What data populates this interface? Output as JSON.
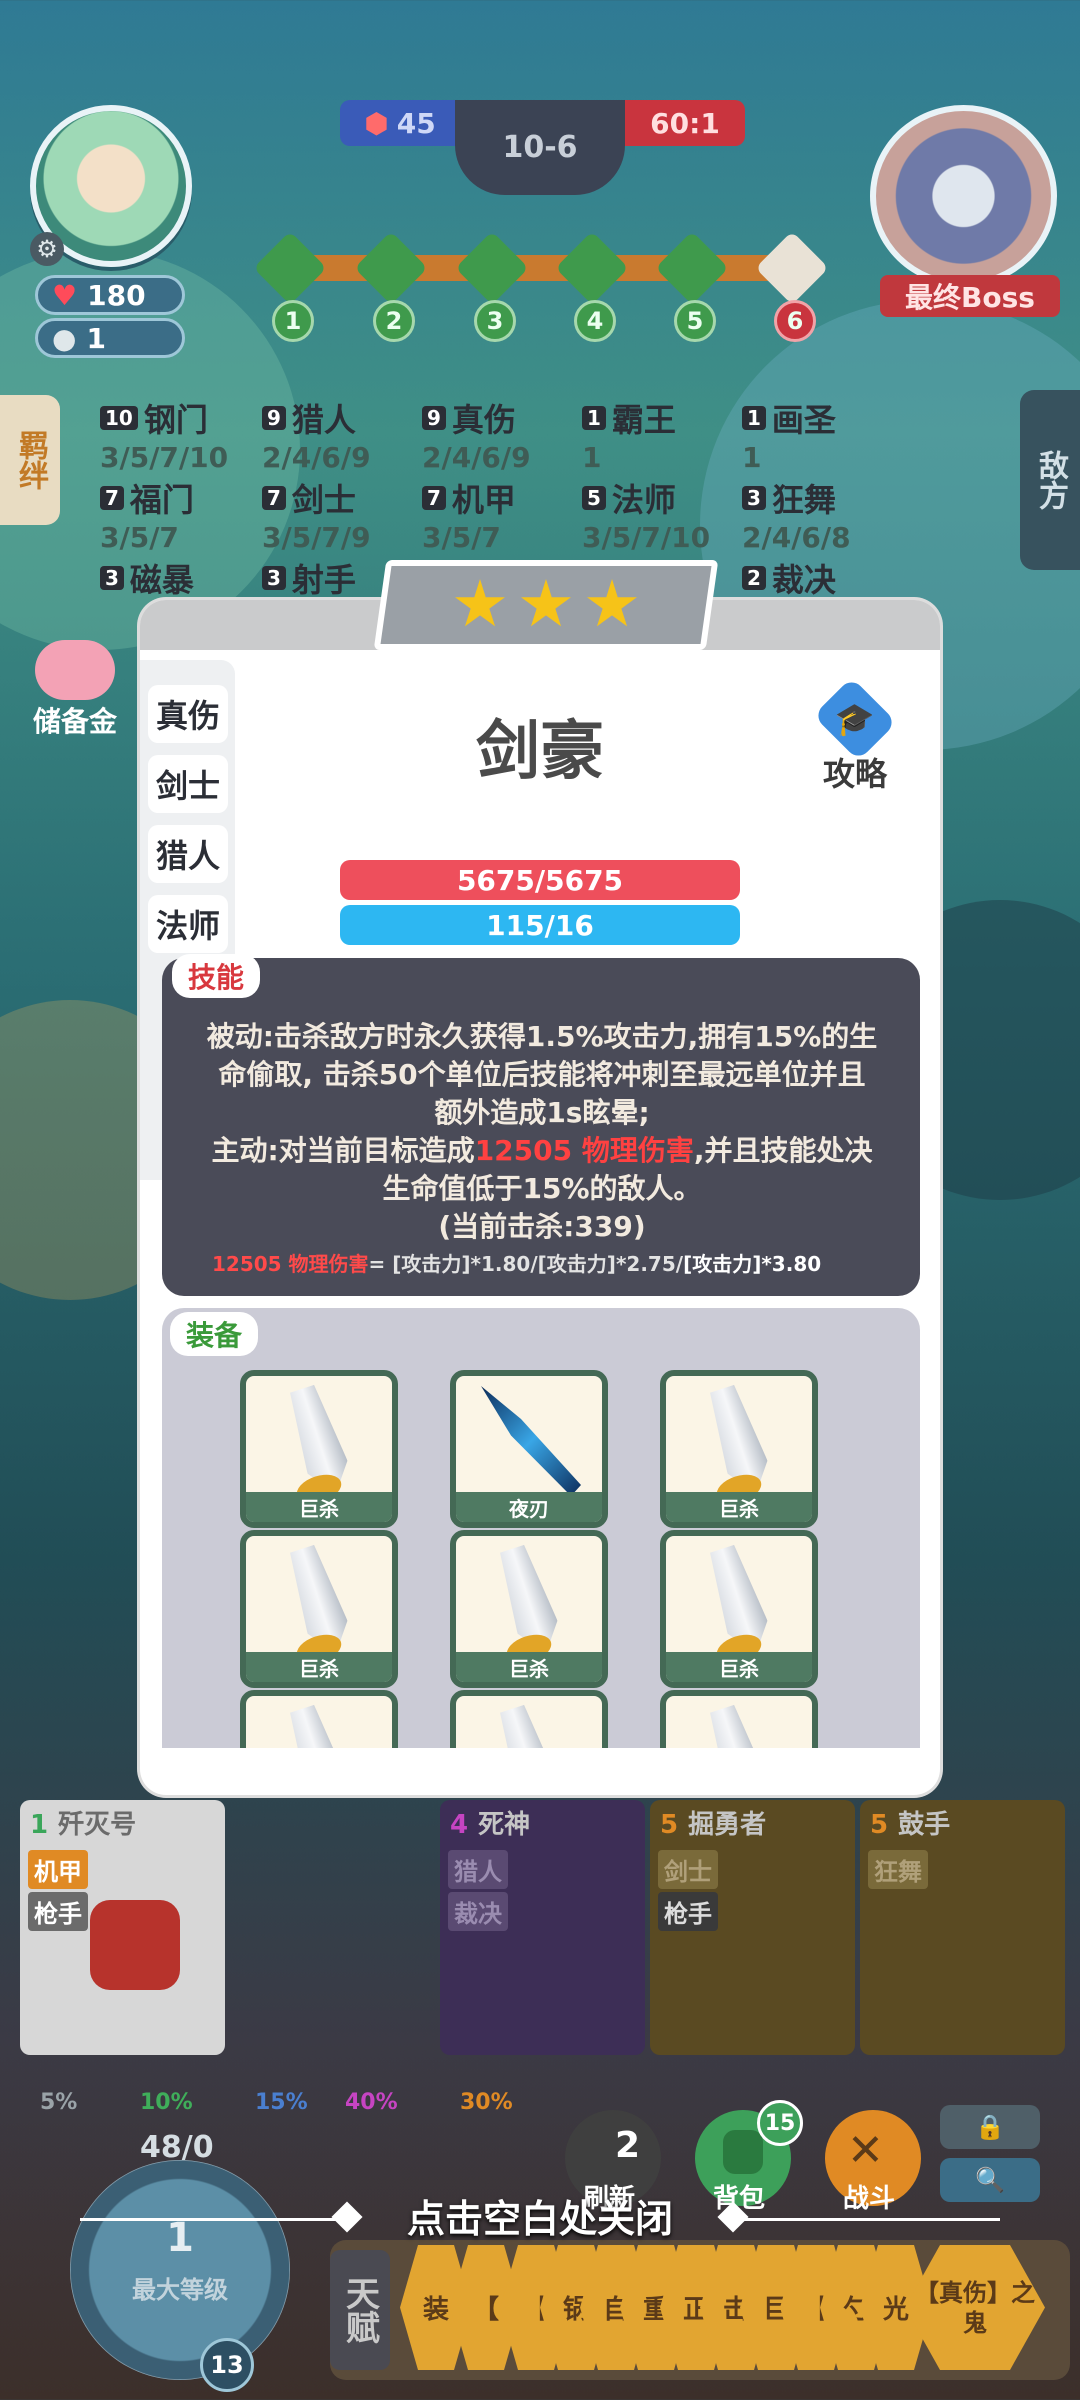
{
  "hud": {
    "hp": "180",
    "coins": "1",
    "left_score": "45",
    "stage": "10-6",
    "right_score": "60:1",
    "boss_label": "最终Boss",
    "nodes": [
      "1",
      "2",
      "3",
      "4",
      "5",
      "6"
    ]
  },
  "side_tabs": {
    "left": "羁绊",
    "right": "敌方",
    "piggy": "储备金"
  },
  "synergies": [
    {
      "count": "10",
      "name": "钢门",
      "tiers": "3/5/7/10"
    },
    {
      "count": "9",
      "name": "猎人",
      "tiers": "2/4/6/9"
    },
    {
      "count": "9",
      "name": "真伤",
      "tiers": "2/4/6/9"
    },
    {
      "count": "1",
      "name": "霸王",
      "tiers": "1"
    },
    {
      "count": "1",
      "name": "画圣",
      "tiers": "1"
    },
    {
      "count": "7",
      "name": "福门",
      "tiers": "3/5/7"
    },
    {
      "count": "7",
      "name": "剑士",
      "tiers": "3/5/7/9"
    },
    {
      "count": "7",
      "name": "机甲",
      "tiers": "3/5/7"
    },
    {
      "count": "5",
      "name": "法师",
      "tiers": "3/5/7/10"
    },
    {
      "count": "3",
      "name": "狂舞",
      "tiers": "2/4/6/8"
    },
    {
      "count": "3",
      "name": "磁暴",
      "tiers": ""
    },
    {
      "count": "3",
      "name": "射手",
      "tiers": ""
    },
    {
      "count": "2",
      "name": "裁决",
      "tiers": ""
    }
  ],
  "modal": {
    "hero_name": "剑豪",
    "guide_label": "攻略",
    "traits": [
      "真伤",
      "剑士",
      "猎人",
      "法师"
    ],
    "hp_bar": "5675/5675",
    "mana_bar": "115/16",
    "skill_tag": "技能",
    "skill_line1": "被动:击杀敌方时永久获得1.5%攻击力,拥有15%的生",
    "skill_line2": "命偷取, 击杀50个单位后技能将冲刺至最远单位并且",
    "skill_line3": "额外造成1s眩晕;",
    "skill_line4a": "主动:对当前目标造成",
    "skill_line4b": "12505 物理伤害",
    "skill_line4c": ",并且技能处决",
    "skill_line5": "生命值低于15%的敌人。",
    "skill_line6": "(当前击杀:339)",
    "formula_red": "12505 物理伤害",
    "formula_rest": "= [攻击力]*1.80/[攻击力]*2.75/",
    "formula_end": "[攻击力]*3.80",
    "equip_tag": "装备",
    "equipment": [
      "巨杀",
      "夜刃",
      "巨杀",
      "巨杀",
      "巨杀",
      "巨杀",
      "",
      "",
      ""
    ]
  },
  "cards": [
    {
      "cost": "1",
      "name": "歼灭号",
      "traits": [
        "机甲",
        "枪手"
      ]
    },
    {
      "cost": "4",
      "name": "死神",
      "traits": [
        "猎人",
        "裁决"
      ]
    },
    {
      "cost": "5",
      "name": "掘勇者",
      "traits": [
        "剑士",
        "枪手"
      ]
    },
    {
      "cost": "5",
      "name": "鼓手",
      "traits": [
        "狂舞"
      ]
    }
  ],
  "odds": [
    "5%",
    "10%",
    "15%",
    "40%",
    "30%"
  ],
  "odds_colors": [
    "#9aa3a8",
    "#3fae5a",
    "#4a7fd0",
    "#c644c2",
    "#e08a24"
  ],
  "level": {
    "xp": "48/0",
    "value": "1",
    "label": "最大等级",
    "badge": "13"
  },
  "buttons": {
    "refresh": "刷新",
    "refresh_cost": "2",
    "bag": "背包",
    "bag_badge": "15",
    "fight": "战斗"
  },
  "close_hint": "点击空白处关闭",
  "talent_label": "天赋",
  "talents": [
    "装",
    "【",
    "【",
    "锅",
    "自",
    "重",
    "正",
    "击",
    "巨",
    "【",
    "勺",
    "光",
    "【真伤】之鬼"
  ]
}
